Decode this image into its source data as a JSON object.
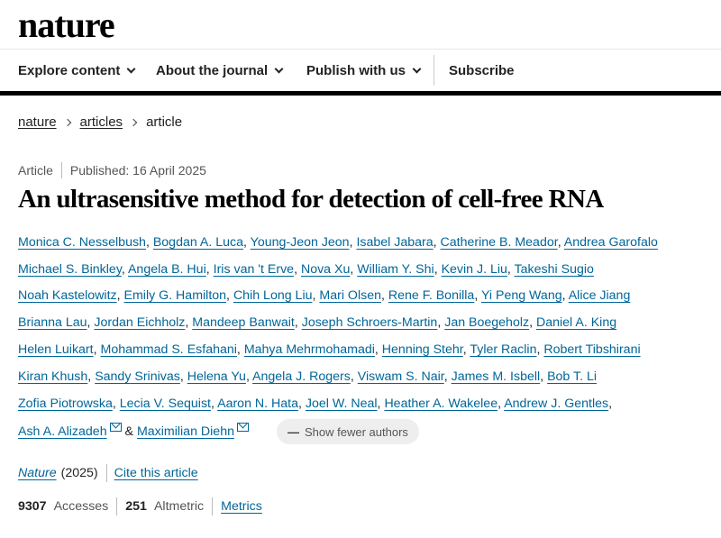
{
  "site": {
    "logo": "nature"
  },
  "nav": {
    "items": [
      {
        "label": "Explore content"
      },
      {
        "label": "About the journal"
      },
      {
        "label": "Publish with us"
      }
    ],
    "subscribe": "Subscribe"
  },
  "breadcrumb": {
    "items": [
      "nature",
      "articles"
    ],
    "current": "article"
  },
  "article": {
    "type": "Article",
    "published": "Published: 16 April 2025",
    "title": "An ultrasensitive method for detection of cell-free RNA",
    "authors": [
      "Monica C. Nesselbush",
      "Bogdan A. Luca",
      "Young-Jeon Jeon",
      "Isabel Jabara",
      "Catherine B. Meador",
      "Andrea Garofalo",
      "Michael S. Binkley",
      "Angela B. Hui",
      "Iris van 't Erve",
      "Nova Xu",
      "William Y. Shi",
      "Kevin J. Liu",
      "Takeshi Sugio",
      "Noah Kastelowitz",
      "Emily G. Hamilton",
      "Chih Long Liu",
      "Mari Olsen",
      "Rene F. Bonilla",
      "Yi Peng Wang",
      "Alice Jiang",
      "Brianna Lau",
      "Jordan Eichholz",
      "Mandeep Banwait",
      "Joseph Schroers-Martin",
      "Jan Boegeholz",
      "Daniel A. King",
      "Helen Luikart",
      "Mohammad S. Esfahani",
      "Mahya Mehrmohamadi",
      "Henning Stehr",
      "Tyler Raclin",
      "Robert Tibshirani",
      "Kiran Khush",
      "Sandy Srinivas",
      "Helena Yu",
      "Angela J. Rogers",
      "Viswam S. Nair",
      "James M. Isbell",
      "Bob T. Li",
      "Zofia Piotrowska",
      "Lecia V. Sequist",
      "Aaron N. Hata",
      "Joel W. Neal",
      "Heather A. Wakelee",
      "Andrew J. Gentles",
      "Ash A. Alizadeh",
      "Maximilian Diehn"
    ],
    "show_fewer": "Show fewer authors",
    "journal": "Nature",
    "year": "(2025)",
    "cite": "Cite this article",
    "accesses_value": "9307",
    "accesses_label": "Accesses",
    "altmetric_value": "251",
    "altmetric_label": "Altmetric",
    "metrics_link": "Metrics"
  }
}
